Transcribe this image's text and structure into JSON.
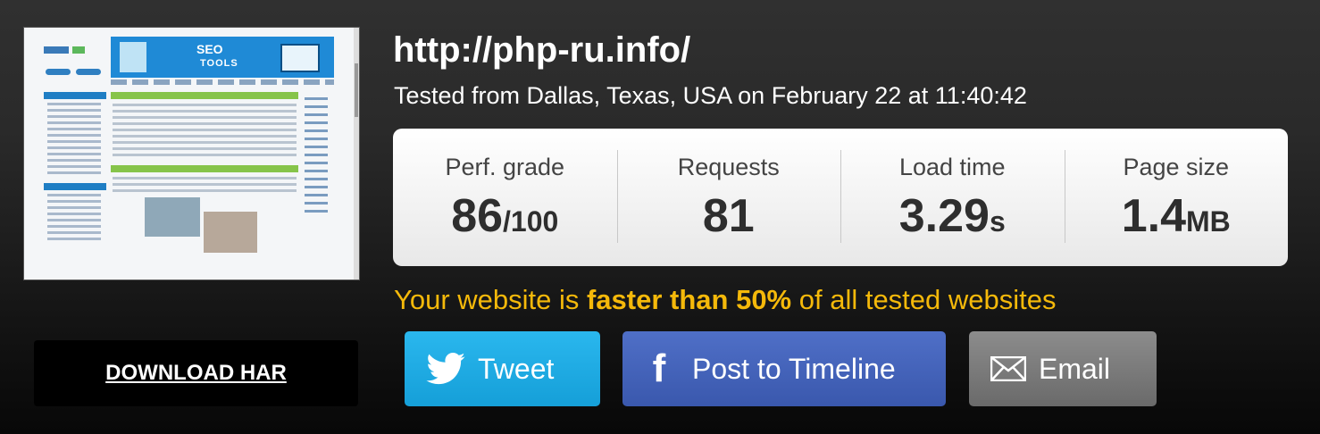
{
  "thumbnail": {
    "banner_line1": "SEO",
    "banner_line2": "TOOLS"
  },
  "download_har_label": "DOWNLOAD HAR",
  "header": {
    "url": "http://php-ru.info/",
    "tested_text": "Tested from Dallas, Texas, USA on February 22 at 11:40:42"
  },
  "stats": [
    {
      "label": "Perf. grade",
      "value": "86",
      "unit": "/100"
    },
    {
      "label": "Requests",
      "value": "81",
      "unit": ""
    },
    {
      "label": "Load time",
      "value": "3.29",
      "unit": "s"
    },
    {
      "label": "Page size",
      "value": "1.4",
      "unit": "MB"
    }
  ],
  "faster": {
    "prefix": "Your website is ",
    "highlight": "faster than 50%",
    "suffix": " of all tested websites"
  },
  "share": {
    "tweet_label": "Tweet",
    "facebook_label": "Post to Timeline",
    "email_label": "Email"
  },
  "icons": {
    "tweet": "twitter-icon",
    "facebook": "facebook-icon",
    "email": "envelope-icon"
  },
  "colors": {
    "highlight_text": "#f5b90a",
    "twitter": "#1aa9e1",
    "facebook": "#4462b8",
    "email": "#7a7a7a"
  }
}
